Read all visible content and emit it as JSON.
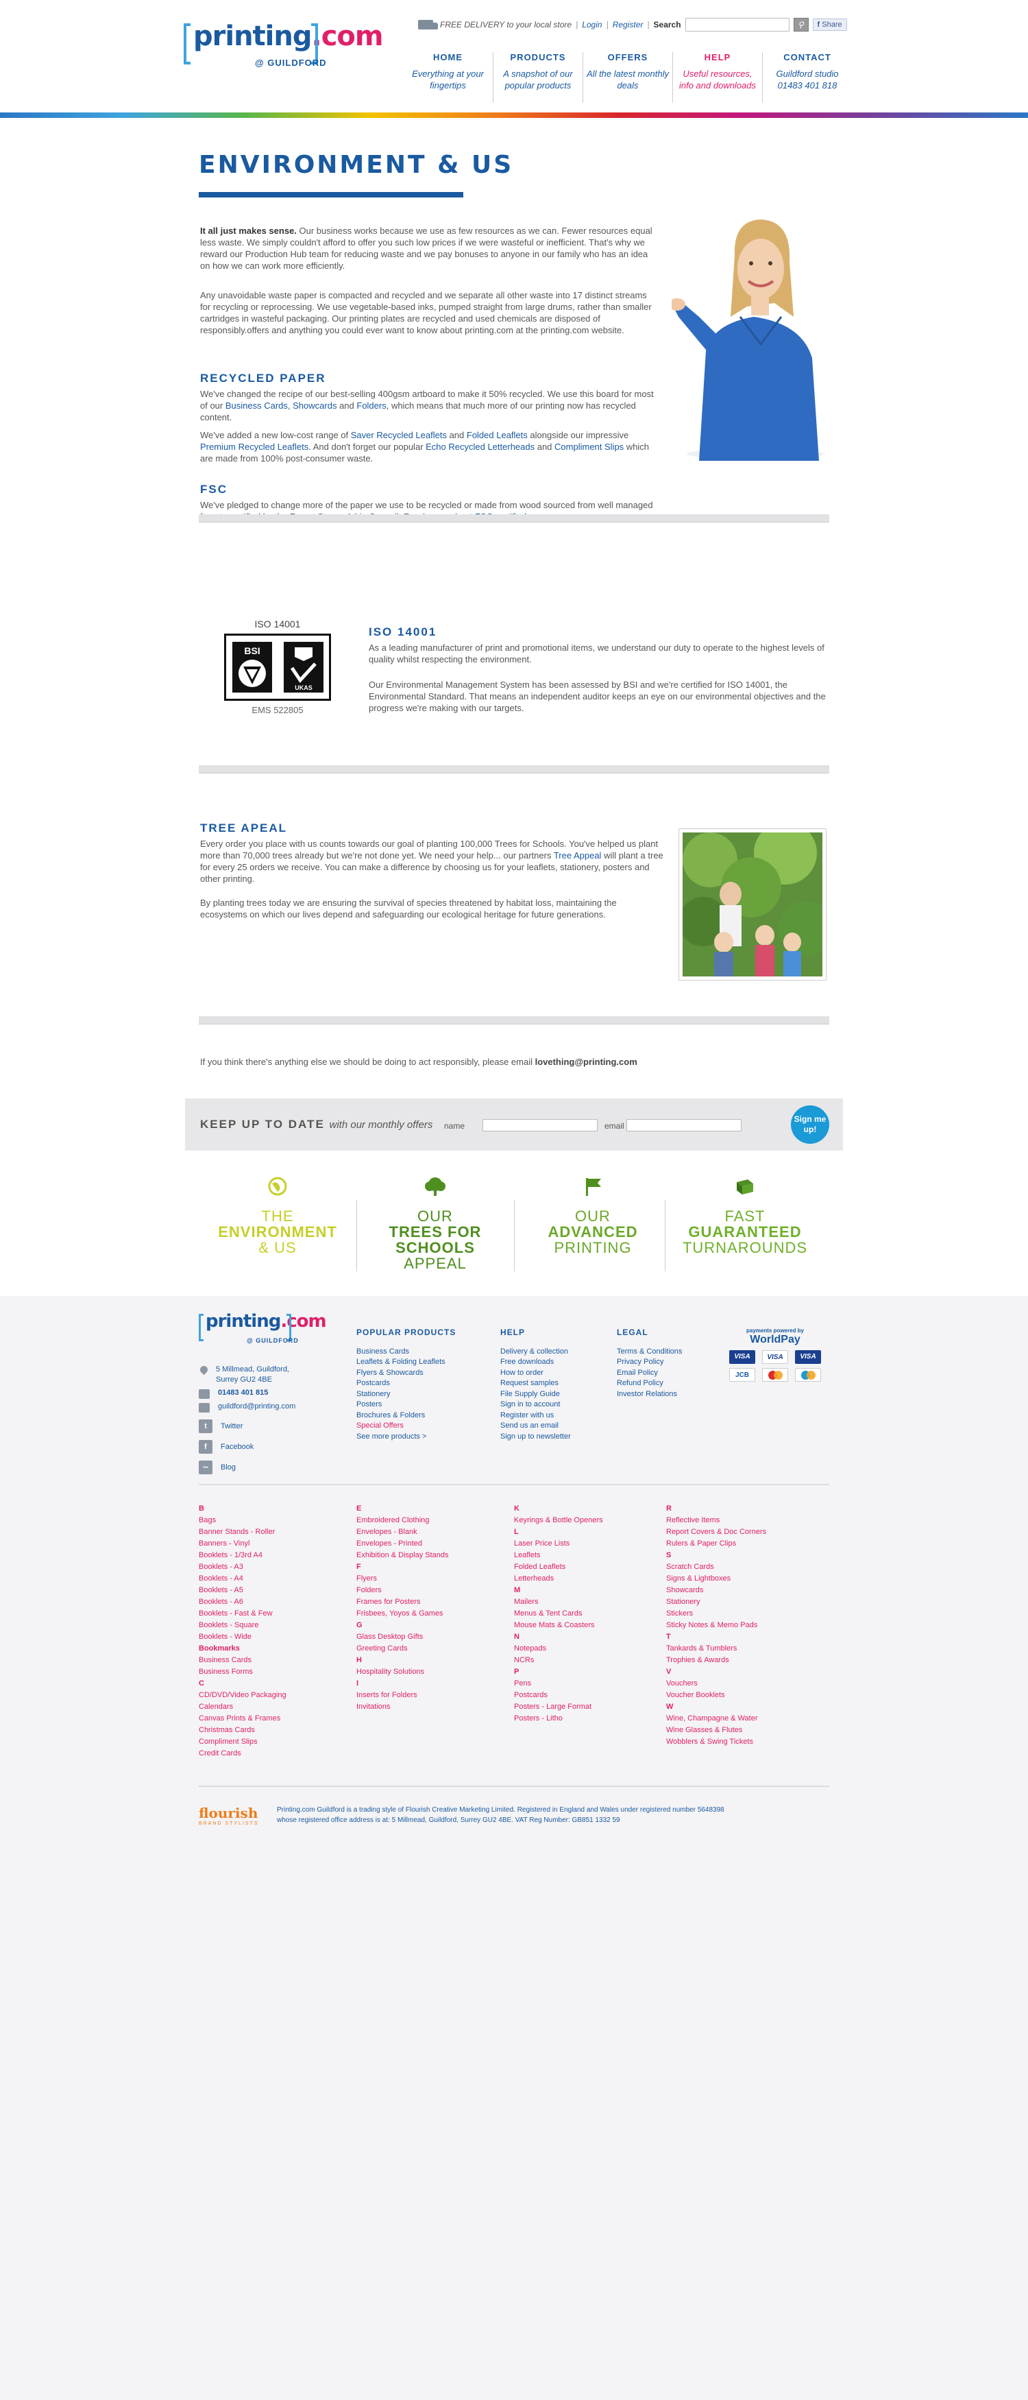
{
  "header": {
    "logo_main": "printing",
    "logo_dot": ".com",
    "logo_sub": "@ GUILDFORD",
    "delivery": "FREE DELIVERY to your local store",
    "login": "Login",
    "register": "Register",
    "search_label": "Search",
    "share": "Share",
    "nav": [
      {
        "title": "HOME",
        "desc": "Everything at your fingertips"
      },
      {
        "title": "PRODUCTS",
        "desc": "A snapshot of our popular products"
      },
      {
        "title": "OFFERS",
        "desc": "All the latest monthly deals"
      },
      {
        "title": "HELP",
        "desc": "Useful resources, info and downloads"
      },
      {
        "title": "CONTACT",
        "desc": "Guildford studio 01483 401 818"
      }
    ]
  },
  "main": {
    "title": "ENVIRONMENT & US",
    "intro_bold": "It all just makes sense.",
    "intro": " Our business works because we use as few resources as we can. Fewer resources equal less waste. We simply couldn't afford to offer you such low prices if we were wasteful or inefficient. That's why we reward our Production Hub team for reducing waste and we pay bonuses to anyone in our family who has an idea on how we can work more efficiently.",
    "waste": "Any unavoidable waste paper is compacted and recycled and we separate all other waste into 17 distinct streams for recycling or reprocessing. We use vegetable-based inks, pumped straight from large drums, rather than smaller cartridges in wasteful packaging. Our printing plates are recycled and used chemicals are disposed of responsibly.offers and anything you could ever want to know about printing.com at the printing.com website.",
    "recycled_title": "RECYCLED PAPER",
    "recycled_1a": "We've changed the recipe of our best-selling 400gsm artboard to make it 50% recycled. We use this board for most of our ",
    "recycled_link1": "Business Cards",
    "recycled_link2": "Showcards",
    "recycled_and": " and ",
    "recycled_link3": "Folders",
    "recycled_1b": ", which means that much more of our printing now has recycled content.",
    "recycled_2a": "We've added a new low-cost range of ",
    "recycled_link4": "Saver Recycled Leaflets",
    "recycled_link5": "Folded Leaflets",
    "recycled_2b": " alongside our impressive ",
    "recycled_link6": "Premium Recycled Leaflets",
    "recycled_2c": ". And don't forget our popular ",
    "recycled_link7": "Echo Recycled Letterheads",
    "recycled_link8": "Compliment Slips",
    "recycled_2d": " which are made from 100% post-consumer waste.",
    "fsc_title": "FSC",
    "fsc_text": "We've pledged to change more of the paper we use to be recycled or made from wood sourced from well managed forests certified by the Forest Stewardship Council. Read more about ",
    "fsc_link": "FSC certified paper",
    "iso_caption": "ISO 14001",
    "iso_ems": "EMS 522805",
    "iso_title": "ISO 14001",
    "iso_text1": "As a leading manufacturer of print and promotional items, we understand our duty to operate to the highest levels of quality whilst respecting the environment.",
    "iso_text2": "Our Environmental Management System has been assessed by BSI and we're certified for ISO 14001, the Environmental Standard. That means an independent auditor keeps an eye on our environmental objectives and the progress we're making with our targets.",
    "tree_title": "TREE APEAL",
    "tree_text1a": "Every order you place with us counts towards our goal of planting 100,000 Trees for Schools. You've helped us plant more than 70,000 trees already but we're not done yet. We need your help... our partners ",
    "tree_link": "Tree Appeal",
    "tree_text1b": " will plant a tree for every 25 orders we receive. You can make a difference by choosing us for your leaflets, stationery, posters and other printing.",
    "tree_text2": "By planting trees today we are ensuring the survival of species threatened by habitat loss, maintaining the ecosystems on which our lives depend and safeguarding our ecological heritage for future generations.",
    "contact_text": "If you think there's anything else we should be doing to act responsibly, please email ",
    "contact_email": "lovething@printing.com"
  },
  "signup": {
    "title": "KEEP UP TO DATE",
    "subtitle": "with our monthly offers",
    "name_label": "name",
    "email_label": "email",
    "button": "Sign me up!"
  },
  "promos": [
    {
      "l1": "THE",
      "l2": "ENVIRONMENT",
      "l3": "& US",
      "color": "#c6cf2a"
    },
    {
      "l1": "OUR",
      "l2": "TREES FOR SCHOOLS",
      "l3": "APPEAL",
      "color": "#4f8f1f"
    },
    {
      "l1": "OUR",
      "l2": "ADVANCED",
      "l3": "PRINTING",
      "color": "#6aa82a"
    },
    {
      "l1": "FAST",
      "l2": "GUARANTEED",
      "l3": "TURNAROUNDS",
      "color": "#6fb02a"
    }
  ],
  "footer": {
    "address1": "5 Millmead, Guildford,",
    "address2": "Surrey GU2 4BE",
    "phone": "01483 401 815",
    "email": "guildford@printing.com",
    "twitter": "Twitter",
    "facebook": "Facebook",
    "blog": "Blog",
    "popular_title": "POPULAR PRODUCTS",
    "popular": [
      "Business Cards",
      "Leaflets & Folding Leaflets",
      "Flyers & Showcards",
      "Postcards",
      "Stationery",
      "Posters",
      "Brochures & Folders"
    ],
    "special": "Special Offers",
    "see_more": "See more products >",
    "help_title": "HELP",
    "help": [
      "Delivery & collection",
      "Free downloads",
      "How to order",
      "Request samples",
      "File Supply Guide",
      "Sign in to account",
      "Register with us",
      "Send us an email",
      "Sign up to newsletter"
    ],
    "legal_title": "LEGAL",
    "legal": [
      "Terms & Conditions",
      "Privacy Policy",
      "Email Policy",
      "Refund Policy",
      "Investor Relations"
    ],
    "pay_text": "payments powered by",
    "worldpay": "WorldPay",
    "cards_row1": [
      "VISA",
      "VISA",
      "VISA"
    ],
    "cards_row2": [
      "JCB",
      "",
      ""
    ],
    "flourish": "flourish",
    "flourish_sub": "BRAND STYLISTS",
    "legal_text1": "Printing.com Guildford is a trading style of Flourish Creative Marketing Limited. Registered in England and Wales under registered number 5648398",
    "legal_text2": "whose registered office address is at: 5 Millmead, Guildford, Surrey GU2 4BE. VAT Reg Number: GB851 1332 59"
  },
  "az_index": [
    {
      "letter": "B",
      "items": [
        "Bags",
        "Banner Stands - Roller",
        "Banners - Vinyl",
        "Booklets - 1/3rd A4",
        "Booklets - A3",
        "Booklets - A4",
        "Booklets - A5",
        "Booklets - A6",
        "Booklets - Fast & Few",
        "Booklets - Square",
        "Booklets - Wide"
      ]
    },
    {
      "letter": "Bookmarks",
      "items": [
        "Business Cards",
        "Business Forms"
      ]
    },
    {
      "letter": "C",
      "items": [
        "CD/DVD/Video Packaging",
        "Calendars",
        "Canvas Prints & Frames",
        "Christmas Cards",
        "Compliment Slips",
        "Credit Cards"
      ]
    },
    {
      "letter": "E",
      "items": [
        "Embroidered Clothing",
        "Envelopes - Blank",
        "Envelopes - Printed",
        "Exhibition & Display Stands"
      ]
    },
    {
      "letter": "F",
      "items": [
        "Flyers",
        "Folders",
        "Frames for Posters",
        "Frisbees, Yoyos & Games"
      ]
    },
    {
      "letter": "G",
      "items": [
        "Glass Desktop Gifts",
        "Greeting Cards"
      ]
    },
    {
      "letter": "H",
      "items": [
        "Hospitality Solutions"
      ]
    },
    {
      "letter": "I",
      "items": [
        "Inserts for Folders",
        "Invitations"
      ]
    },
    {
      "letter": "K",
      "items": [
        "Keyrings & Bottle Openers"
      ]
    },
    {
      "letter": "L",
      "items": [
        "Laser Price Lists",
        "Leaflets",
        "Folded Leaflets",
        "Letterheads"
      ]
    },
    {
      "letter": "M",
      "items": [
        "Mailers",
        "Menus & Tent Cards",
        "Mouse Mats & Coasters"
      ]
    },
    {
      "letter": "N",
      "items": [
        "Notepads",
        "NCRs"
      ]
    },
    {
      "letter": "P",
      "items": [
        "Pens",
        "Postcards",
        "Posters - Large Format",
        "Posters - Litho"
      ]
    },
    {
      "letter": "R",
      "items": [
        "Reflective Items",
        "Report Covers & Doc Corners",
        "Rulers & Paper Clips"
      ]
    },
    {
      "letter": "S",
      "items": [
        "Scratch Cards",
        "Signs & Lightboxes",
        "Showcards",
        "Stationery",
        "Stickers",
        "Sticky Notes & Memo Pads"
      ]
    },
    {
      "letter": "T",
      "items": [
        "Tankards & Tumblers",
        "Trophies & Awards"
      ]
    },
    {
      "letter": "V",
      "items": [
        "Vouchers",
        "Voucher Booklets"
      ]
    },
    {
      "letter": "W",
      "items": [
        "Wine, Champagne & Water",
        "Wine Glasses & Flutes",
        "Wobblers & Swing Tickets"
      ]
    }
  ]
}
